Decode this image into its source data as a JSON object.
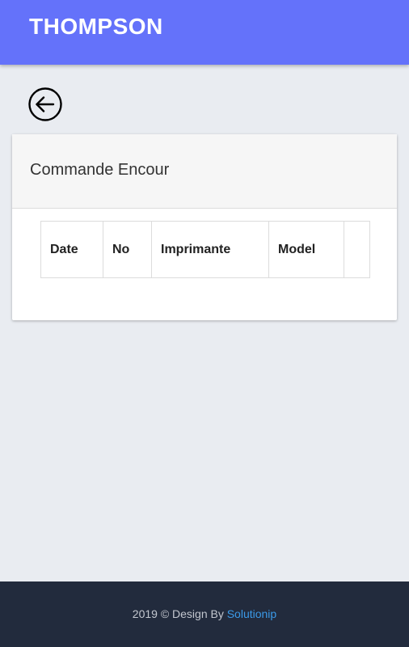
{
  "header": {
    "brand": "THOMPSON"
  },
  "card": {
    "title": "Commande Encour",
    "table": {
      "columns": [
        "Date",
        "No",
        "Imprimante",
        "Model",
        ""
      ],
      "rows": []
    }
  },
  "footer": {
    "prefix": "2019 © Design By",
    "link_label": "Solutionip"
  },
  "colors": {
    "topbar": "#6472fa",
    "background": "#e9ecf1",
    "footer": "#222b3d",
    "link": "#3b9ae8"
  },
  "icons": {
    "back": "arrow-left-circle-icon"
  }
}
